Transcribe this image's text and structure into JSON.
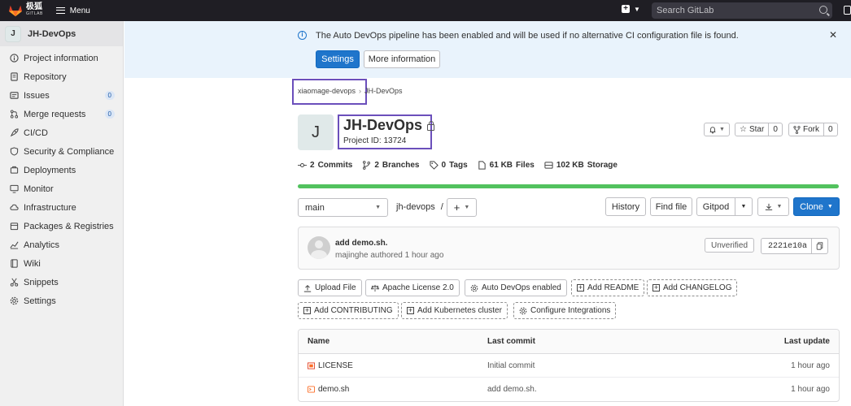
{
  "topbar": {
    "brand_cn": "极狐",
    "brand_en": "GITLAB",
    "menu_label": "Menu",
    "search_placeholder": "Search GitLab",
    "plus_icon": "plus-square-icon"
  },
  "sidebar": {
    "project_initial": "J",
    "project_name": "JH-DevOps",
    "items": [
      {
        "label": "Project information",
        "icon": "info-icon"
      },
      {
        "label": "Repository",
        "icon": "doc-icon"
      },
      {
        "label": "Issues",
        "icon": "issues-icon",
        "badge": "0"
      },
      {
        "label": "Merge requests",
        "icon": "merge-icon",
        "badge": "0"
      },
      {
        "label": "CI/CD",
        "icon": "rocket-icon"
      },
      {
        "label": "Security & Compliance",
        "icon": "shield-icon"
      },
      {
        "label": "Deployments",
        "icon": "deploy-icon"
      },
      {
        "label": "Monitor",
        "icon": "monitor-icon"
      },
      {
        "label": "Infrastructure",
        "icon": "cloud-icon"
      },
      {
        "label": "Packages & Registries",
        "icon": "package-icon"
      },
      {
        "label": "Analytics",
        "icon": "chart-icon"
      },
      {
        "label": "Wiki",
        "icon": "book-icon"
      },
      {
        "label": "Snippets",
        "icon": "scissors-icon"
      },
      {
        "label": "Settings",
        "icon": "gear-icon"
      }
    ]
  },
  "banner": {
    "message": "The Auto DevOps pipeline has been enabled and will be used if no alternative CI configuration file is found.",
    "settings_label": "Settings",
    "more_label": "More information",
    "close": "✕"
  },
  "breadcrumb": {
    "group": "xiaomage-devops",
    "project": "JH-DevOps"
  },
  "project": {
    "initial": "J",
    "title": "JH-DevOps",
    "id_text": "Project ID: 13724",
    "star_label": "Star",
    "star_count": "0",
    "fork_label": "Fork",
    "fork_count": "0"
  },
  "stats": {
    "commits": "2",
    "commits_label": "Commits",
    "branches": "2",
    "branches_label": "Branches",
    "tags": "0",
    "tags_label": "Tags",
    "files": "61 KB",
    "files_label": "Files",
    "storage": "102 KB",
    "storage_label": "Storage"
  },
  "controls": {
    "branch": "main",
    "path": "jh-devops",
    "path_sep": "/",
    "history": "History",
    "find_file": "Find file",
    "gitpod": "Gitpod",
    "clone": "Clone"
  },
  "commit": {
    "message": "add demo.sh.",
    "meta": "majinghe authored 1 hour ago",
    "unverified": "Unverified",
    "sha": "2221e10a"
  },
  "quick_actions": {
    "upload": "Upload File",
    "license": "Apache License 2.0",
    "autodevops": "Auto DevOps enabled",
    "readme": "Add README",
    "changelog": "Add CHANGELOG",
    "contributing": "Add CONTRIBUTING",
    "k8s": "Add Kubernetes cluster",
    "integrations": "Configure Integrations"
  },
  "table": {
    "headers": {
      "name": "Name",
      "last_commit": "Last commit",
      "last_update": "Last update"
    },
    "rows": [
      {
        "name": "LICENSE",
        "commit": "Initial commit",
        "updated": "1 hour ago"
      },
      {
        "name": "demo.sh",
        "commit": "add demo.sh.",
        "updated": "1 hour ago"
      }
    ]
  },
  "colors": {
    "primary": "#1f75cb",
    "highlight": "#6b4fbb",
    "progress": "#52c25e",
    "topbar": "#1f1e24"
  }
}
